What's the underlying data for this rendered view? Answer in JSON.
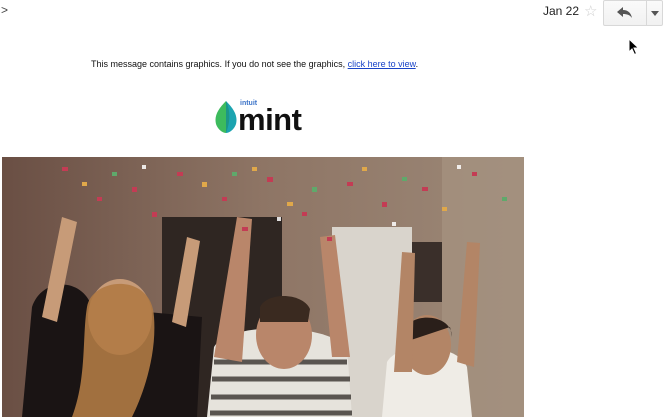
{
  "header": {
    "sender_tail": ">",
    "date": "Jan 22",
    "star_icon": "star-outline-icon",
    "reply_icon": "reply-arrow-icon",
    "more_icon": "caret-down-icon"
  },
  "email": {
    "graphics_note_prefix": "This message contains graphics. If you do not see the graphics, ",
    "graphics_note_link": "click here to view",
    "graphics_note_suffix": ".",
    "logo": {
      "brand_small": "intuit",
      "brand_main": "mint",
      "icon": "mint-leaf-icon"
    },
    "hero_image": "people-throwing-confetti-photo"
  },
  "colors": {
    "link": "#1a44c8",
    "brand_blue": "#3b73c8",
    "leaf_green": "#3dbb5d",
    "leaf_teal": "#1ca4b0"
  }
}
